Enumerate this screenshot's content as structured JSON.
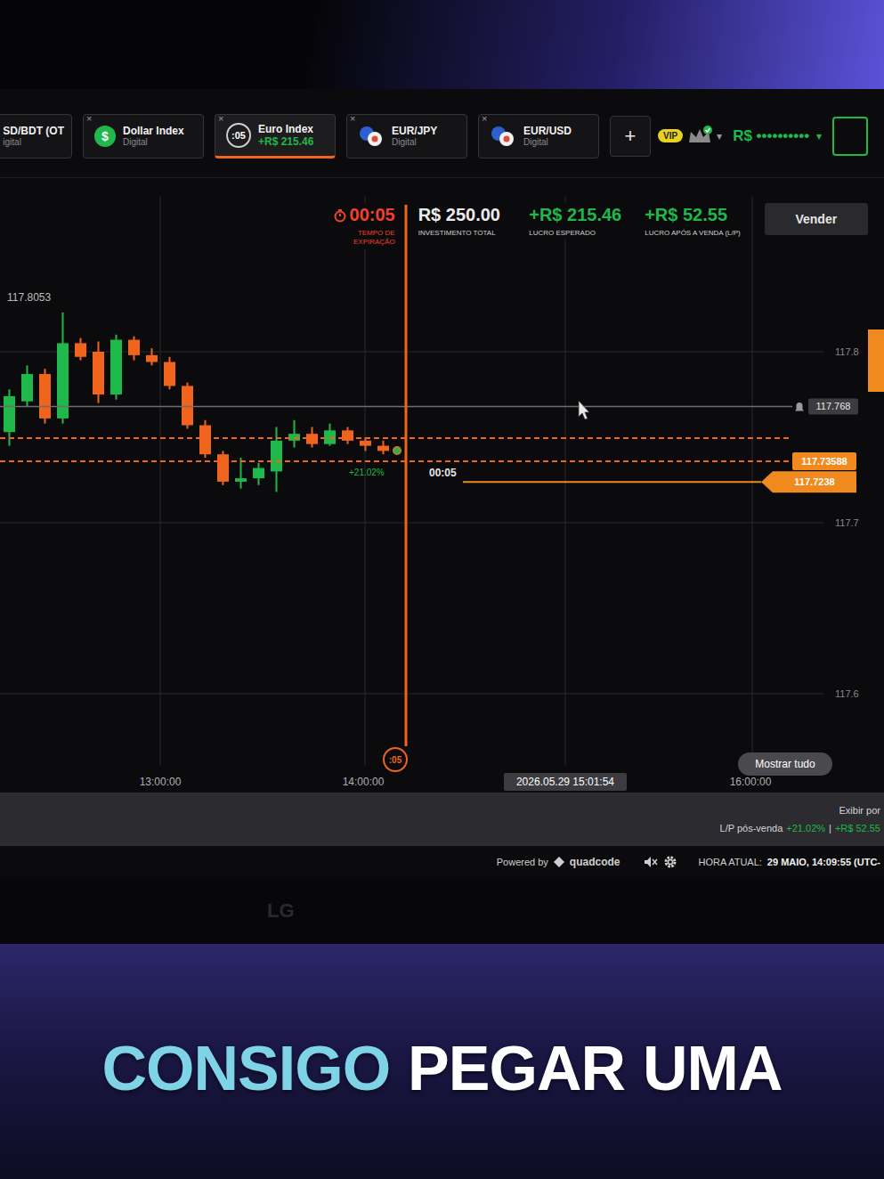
{
  "tabs": [
    {
      "label": "SD/BDT (OT",
      "sub": "igital",
      "kind": "plain",
      "icon_text": "",
      "selected": false
    },
    {
      "label": "Dollar Index",
      "sub": "Digital",
      "kind": "dollar",
      "icon_text": "$",
      "selected": false
    },
    {
      "label": "Euro Index",
      "sub": "+R$ 215.46",
      "kind": "timer",
      "icon_text": ":05",
      "selected": true
    },
    {
      "label": "EUR/JPY",
      "sub": "Digital",
      "kind": "pair",
      "icon_text": "",
      "selected": false
    },
    {
      "label": "EUR/USD",
      "sub": "Digital",
      "kind": "pair",
      "icon_text": "",
      "selected": false
    }
  ],
  "tab_close": "×",
  "account": {
    "add_button": "+",
    "vip": "VIP",
    "balance": "R$ ••••••••••",
    "caret": "▾"
  },
  "trade": {
    "timer": "00:05",
    "timer_label": "TEMPO DE EXPIRAÇÃO",
    "investment": "R$ 250.00",
    "investment_label": "INVESTIMENTO TOTAL",
    "expected": "+R$ 215.46",
    "expected_label": "LUCRO ESPERADO",
    "after_sale": "+R$ 52.55",
    "after_sale_label": "LUCRO APÓS A VENDA (L/P)",
    "sell_button": "Vender"
  },
  "chart": {
    "high_label": "117.8053",
    "price_ticks": [
      {
        "label": "117.8",
        "kind": "axis"
      },
      {
        "label": "117.768",
        "kind": "alert"
      },
      {
        "label": "117.73588",
        "kind": "current"
      },
      {
        "label": "117.7238",
        "kind": "open"
      },
      {
        "label": "117.7",
        "kind": "axis"
      },
      {
        "label": "117.6",
        "kind": "axis"
      }
    ],
    "entry_line": 117.7495,
    "countdown": "00:05",
    "trade_percent": "+21.02%",
    "expiry_marker": ":05",
    "time_ticks": [
      "13:00:00",
      "14:00:00",
      "16:00:00"
    ],
    "cursor_time": "2026.05.29 15:01:54",
    "show_all": "Mostrar tudo",
    "candles": [
      {
        "o": 117.753,
        "h": 117.778,
        "l": 117.745,
        "c": 117.774
      },
      {
        "o": 117.771,
        "h": 117.792,
        "l": 117.768,
        "c": 117.787
      },
      {
        "o": 117.787,
        "h": 117.79,
        "l": 117.758,
        "c": 117.761
      },
      {
        "o": 117.761,
        "h": 117.823,
        "l": 117.758,
        "c": 117.805
      },
      {
        "o": 117.805,
        "h": 117.808,
        "l": 117.795,
        "c": 117.797
      },
      {
        "o": 117.8,
        "h": 117.806,
        "l": 117.77,
        "c": 117.775
      },
      {
        "o": 117.775,
        "h": 117.81,
        "l": 117.772,
        "c": 117.807
      },
      {
        "o": 117.807,
        "h": 117.809,
        "l": 117.795,
        "c": 117.798
      },
      {
        "o": 117.798,
        "h": 117.802,
        "l": 117.792,
        "c": 117.794
      },
      {
        "o": 117.794,
        "h": 117.797,
        "l": 117.778,
        "c": 117.78
      },
      {
        "o": 117.78,
        "h": 117.782,
        "l": 117.755,
        "c": 117.757
      },
      {
        "o": 117.757,
        "h": 117.76,
        "l": 117.738,
        "c": 117.74
      },
      {
        "o": 117.74,
        "h": 117.742,
        "l": 117.722,
        "c": 117.724
      },
      {
        "o": 117.724,
        "h": 117.738,
        "l": 117.72,
        "c": 117.726
      },
      {
        "o": 117.726,
        "h": 117.735,
        "l": 117.722,
        "c": 117.732
      },
      {
        "o": 117.73,
        "h": 117.756,
        "l": 117.718,
        "c": 117.748
      },
      {
        "o": 117.748,
        "h": 117.76,
        "l": 117.744,
        "c": 117.752
      },
      {
        "o": 117.752,
        "h": 117.756,
        "l": 117.744,
        "c": 117.746
      },
      {
        "o": 117.746,
        "h": 117.758,
        "l": 117.745,
        "c": 117.754
      },
      {
        "o": 117.754,
        "h": 117.756,
        "l": 117.746,
        "c": 117.748
      },
      {
        "o": 117.748,
        "h": 117.75,
        "l": 117.742,
        "c": 117.745
      },
      {
        "o": 117.745,
        "h": 117.748,
        "l": 117.74,
        "c": 117.742
      }
    ]
  },
  "footer": {
    "view_by": "Exibir por",
    "lp_label": "L/P pós-venda",
    "lp_percent": "+21.02%",
    "lp_separator": "|",
    "lp_value": "+R$ 52.55"
  },
  "status_bar": {
    "powered_by": "Powered by",
    "brand": "quadcode",
    "time_label": "HORA ATUAL:",
    "time_value": "29 MAIO, 14:09:55 (UTC-"
  },
  "monitor_logo": "LG",
  "caption": [
    {
      "text": "CONSIGO",
      "highlight": true
    },
    {
      "text": "PEGAR",
      "highlight": false
    },
    {
      "text": "UMA",
      "highlight": false
    }
  ]
}
